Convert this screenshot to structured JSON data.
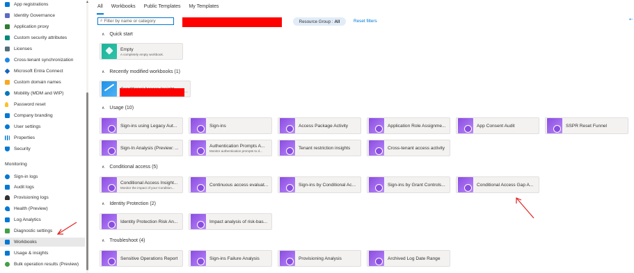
{
  "sidebar": {
    "items_top": [
      {
        "label": "App registrations",
        "icon": "app-registrations-icon",
        "color": "#0078d4"
      },
      {
        "label": "Identity Governance",
        "icon": "identity-governance-icon",
        "color": "#5c6bc0"
      },
      {
        "label": "Application proxy",
        "icon": "application-proxy-icon",
        "color": "#2e7d32"
      },
      {
        "label": "Custom security attributes",
        "icon": "custom-security-attributes-icon",
        "color": "#00897b"
      },
      {
        "label": "Licenses",
        "icon": "licenses-icon",
        "color": "#546e7a"
      },
      {
        "label": "Cross-tenant synchronization",
        "icon": "cross-tenant-sync-icon",
        "color": "#1e88e5"
      },
      {
        "label": "Microsoft Entra Connect",
        "icon": "entra-connect-icon",
        "color": "#1565c0"
      },
      {
        "label": "Custom domain names",
        "icon": "custom-domain-names-icon",
        "color": "#f9a825"
      },
      {
        "label": "Mobility (MDM and WIP)",
        "icon": "mobility-icon",
        "color": "#0277bd"
      },
      {
        "label": "Password reset",
        "icon": "password-reset-key-icon",
        "color": "#fbc02d"
      },
      {
        "label": "Company branding",
        "icon": "company-branding-icon",
        "color": "#0078d4"
      },
      {
        "label": "User settings",
        "icon": "user-settings-icon",
        "color": "#0078d4"
      },
      {
        "label": "Properties",
        "icon": "properties-icon",
        "color": "#0078d4"
      },
      {
        "label": "Security",
        "icon": "security-shield-icon",
        "color": "#0078d4"
      }
    ],
    "monitoring_title": "Monitoring",
    "items_monitoring": [
      {
        "label": "Sign-in logs",
        "icon": "sign-in-logs-icon",
        "color": "#0078d4"
      },
      {
        "label": "Audit logs",
        "icon": "audit-logs-icon",
        "color": "#0078d4"
      },
      {
        "label": "Provisioning logs",
        "icon": "provisioning-logs-icon",
        "color": "#323130"
      },
      {
        "label": "Health (Preview)",
        "icon": "health-heart-icon",
        "color": "#0078d4"
      },
      {
        "label": "Log Analytics",
        "icon": "log-analytics-icon",
        "color": "#0078d4"
      },
      {
        "label": "Diagnostic settings",
        "icon": "diagnostic-settings-icon",
        "color": "#43a047"
      },
      {
        "label": "Workbooks",
        "icon": "workbooks-icon",
        "color": "#0078d4",
        "selected": true
      },
      {
        "label": "Usage & insights",
        "icon": "usage-insights-icon",
        "color": "#0078d4"
      },
      {
        "label": "Bulk operation results (Preview)",
        "icon": "bulk-operation-icon",
        "color": "#43a047"
      }
    ]
  },
  "tabs": [
    "All",
    "Workbooks",
    "Public Templates",
    "My Templates"
  ],
  "active_tab": "All",
  "search": {
    "placeholder": "Filter by name or category",
    "value": ""
  },
  "resource_group": {
    "label": "Resource Group :",
    "value": "All"
  },
  "reset_filters": "Reset filters",
  "sections": {
    "quick_start": {
      "title": "Quick start",
      "cards": [
        {
          "title": "Empty",
          "subtitle": "A completely empty workbook."
        }
      ]
    },
    "recent": {
      "title": "Recently modified workbooks (1)",
      "cards": [
        {
          "title": "Conditional Access Insight..."
        }
      ]
    },
    "usage": {
      "title": "Usage (10)",
      "cards": [
        {
          "title": "Sign-ins using Legacy Aut..."
        },
        {
          "title": "Sign-ins"
        },
        {
          "title": "Access Package Activity"
        },
        {
          "title": "Application Role Assignme..."
        },
        {
          "title": "App Consent Audit"
        },
        {
          "title": "SSPR Reset Funnel"
        },
        {
          "title": "Sign-In Analysis (Preview: ..."
        },
        {
          "title": "Authentication Prompts A...",
          "subtitle": "Monitor authentication prompts to d..."
        },
        {
          "title": "Tenant restriction insights"
        },
        {
          "title": "Cross-tenant access activity"
        }
      ]
    },
    "conditional_access": {
      "title": "Conditional access (5)",
      "cards": [
        {
          "title": "Conditional Access Insight...",
          "subtitle": "Monitor the impact of your Condition..."
        },
        {
          "title": "Continuous access evaluat..."
        },
        {
          "title": "Sign-ins by Conditional Ac..."
        },
        {
          "title": "Sign-ins by Grant Controls..."
        },
        {
          "title": "Conditional Access Gap A..."
        }
      ]
    },
    "identity_protection": {
      "title": "Identity Protection (2)",
      "cards": [
        {
          "title": "Identity Protection Risk An..."
        },
        {
          "title": "Impact analysis of risk-bas..."
        }
      ]
    },
    "troubleshoot": {
      "title": "Troubleshoot (4)",
      "cards": [
        {
          "title": "Sensitive Operations Report"
        },
        {
          "title": "Sign-ins Failure Analysis"
        },
        {
          "title": "Provisioning Analysis"
        },
        {
          "title": "Archived Log Date Range"
        }
      ]
    }
  },
  "colors": {
    "accent": "#0078d4",
    "card_bg": "#f3f2f1",
    "annotation_arrow": "#e02020",
    "redaction": "#ff0000",
    "purple_icon": "#8a4de0"
  }
}
